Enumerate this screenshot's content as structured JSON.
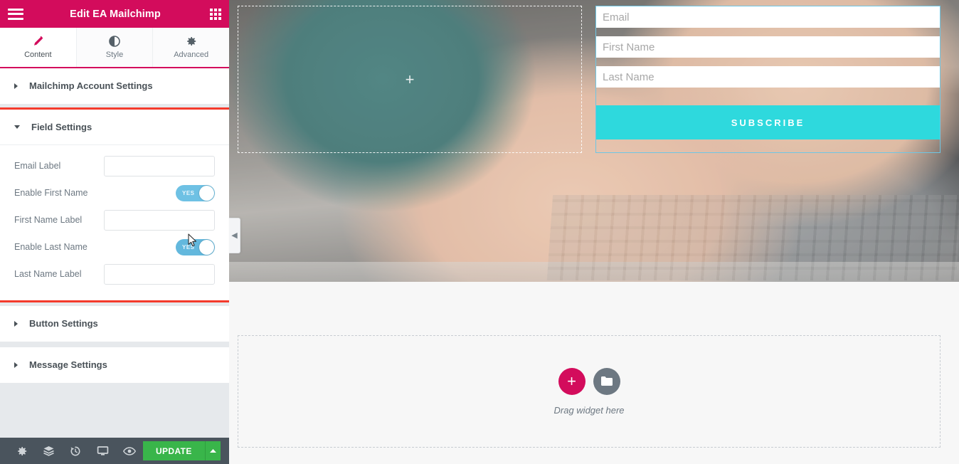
{
  "panel": {
    "header": {
      "title": "Edit EA Mailchimp",
      "menu_icon": "hamburger-icon",
      "apps_icon": "apps-grid-icon"
    },
    "tabs": [
      {
        "label": "Content",
        "icon": "pencil-icon",
        "active": true
      },
      {
        "label": "Style",
        "icon": "contrast-circle-icon",
        "active": false
      },
      {
        "label": "Advanced",
        "icon": "gear-icon",
        "active": false
      }
    ],
    "sections": [
      {
        "title": "Mailchimp Account Settings",
        "open": false,
        "highlighted": false
      },
      {
        "title": "Field Settings",
        "open": true,
        "highlighted": true
      },
      {
        "title": "Button Settings",
        "open": false,
        "highlighted": false
      },
      {
        "title": "Message Settings",
        "open": false,
        "highlighted": false
      }
    ],
    "field_settings": {
      "rows": [
        {
          "label": "Email Label",
          "type": "text",
          "value": "",
          "placeholder": ""
        },
        {
          "label": "Enable First Name",
          "type": "switch",
          "value": "YES"
        },
        {
          "label": "First Name Label",
          "type": "text",
          "value": "",
          "placeholder": ""
        },
        {
          "label": "Enable Last Name",
          "type": "switch",
          "value": "YES"
        },
        {
          "label": "Last Name Label",
          "type": "text",
          "value": "",
          "placeholder": ""
        }
      ]
    },
    "collapse_handle": {
      "icon": "chevron-left-icon"
    },
    "footer": {
      "icons": [
        {
          "name": "settings-gear-icon"
        },
        {
          "name": "layers-navigator-icon"
        },
        {
          "name": "history-icon"
        },
        {
          "name": "responsive-mode-icon"
        },
        {
          "name": "preview-eye-icon"
        }
      ],
      "update_label": "UPDATE",
      "update_caret_icon": "caret-up-icon"
    }
  },
  "canvas": {
    "section_left": {
      "add_icon": "plus-icon"
    },
    "mailchimp_widget": {
      "fields": [
        {
          "name": "email",
          "placeholder": "Email"
        },
        {
          "name": "first-name",
          "placeholder": "First Name"
        },
        {
          "name": "last-name",
          "placeholder": "Last Name"
        }
      ],
      "submit_label": "SUBSCRIBE"
    },
    "dropzone": {
      "add_icon": "plus-icon",
      "template_icon": "folder-icon",
      "text": "Drag widget here"
    }
  },
  "colors": {
    "brand_pink": "#d30c5c",
    "accent_turquoise": "#2ed9dd",
    "update_green": "#39b54a",
    "switch_blue": "#6ec1e4",
    "highlight_red": "#f43a2c",
    "selection_blue": "#6ec6e4",
    "panel_bg": "#e6e9ec",
    "footer_bg": "#4a545d"
  }
}
